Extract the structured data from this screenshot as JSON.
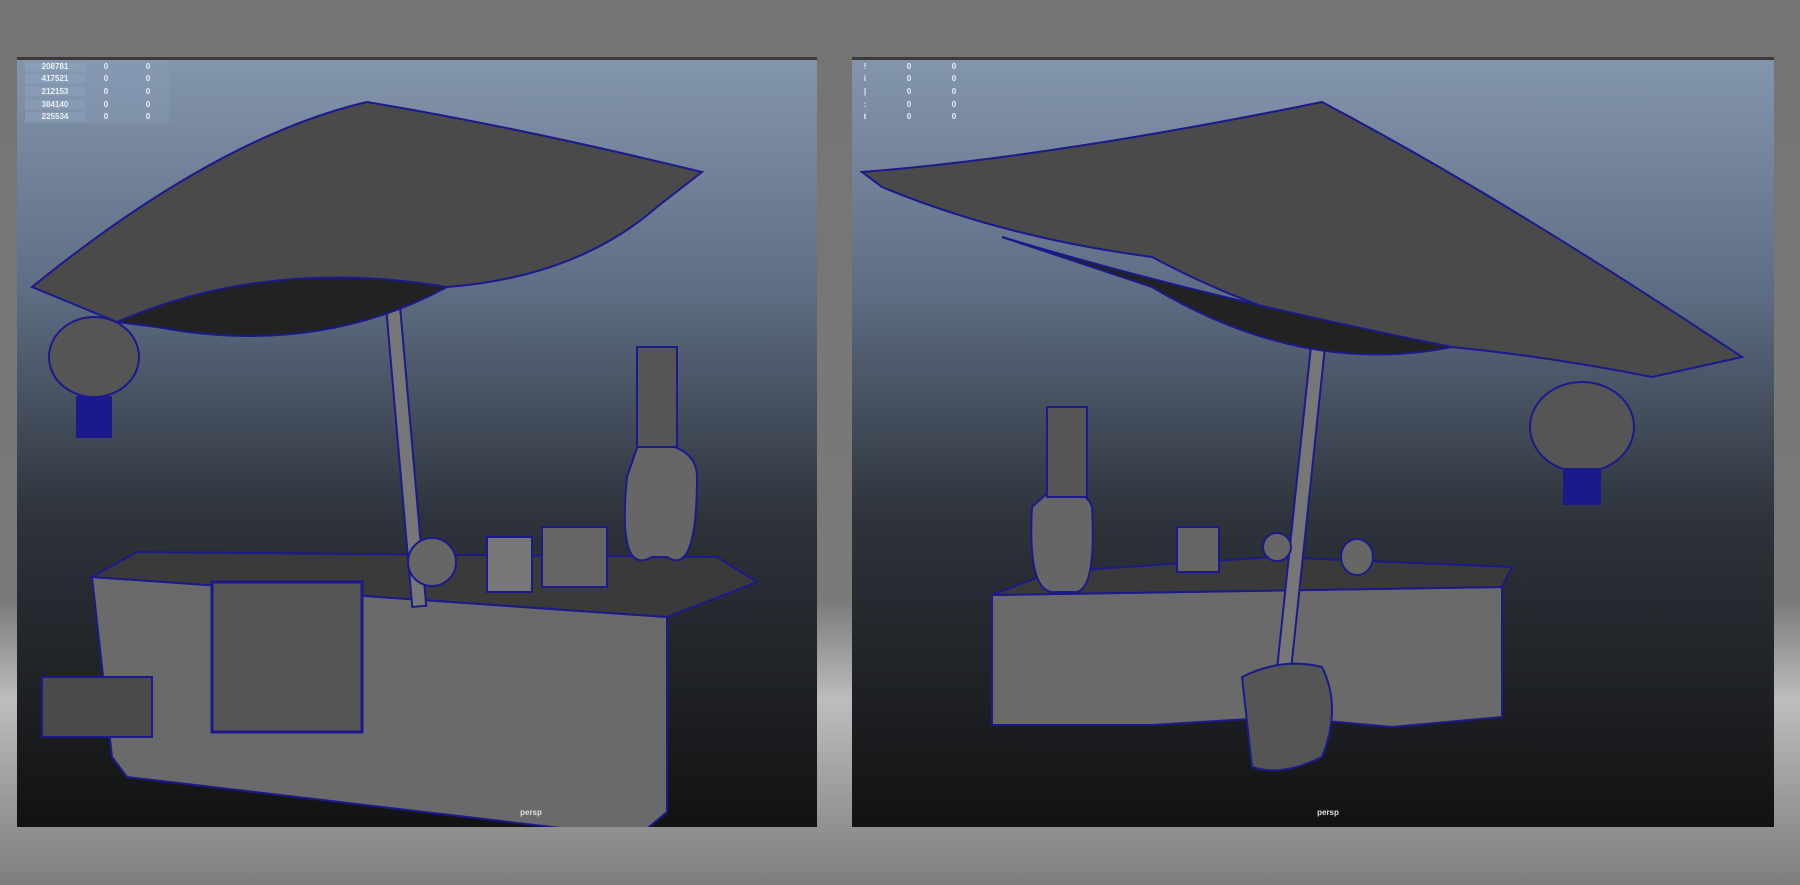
{
  "viewports": [
    {
      "camera": "persp",
      "stats": [
        [
          "208781",
          "0",
          "0"
        ],
        [
          "417521",
          "0",
          "0"
        ],
        [
          "212153",
          "0",
          "0"
        ],
        [
          "384140",
          "0",
          "0"
        ],
        [
          "225534",
          "0",
          "0"
        ]
      ]
    },
    {
      "camera": "persp",
      "stats": [
        [
          "!",
          "0",
          "0"
        ],
        [
          "i",
          "0",
          "0"
        ],
        [
          "|",
          "0",
          "0"
        ],
        [
          ":",
          "0",
          "0"
        ],
        [
          "t",
          "0",
          "0"
        ]
      ]
    }
  ],
  "colors": {
    "wire": "#1a1a8c",
    "mesh": "#5a5a5a",
    "canopy": "#4a4a4a"
  }
}
